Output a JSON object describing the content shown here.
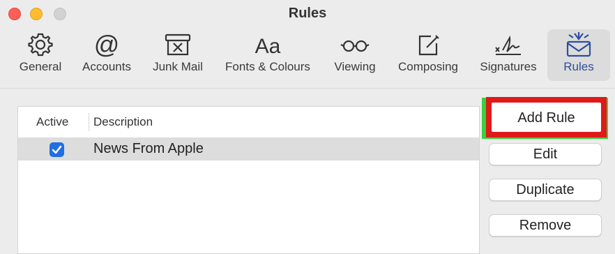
{
  "window": {
    "title": "Rules",
    "traffic_lights": {
      "close": "#fe5f57",
      "minimize": "#febc2e",
      "zoom": "#d2d2d2"
    }
  },
  "toolbar": {
    "items": [
      {
        "label": "General",
        "icon": "gear-icon"
      },
      {
        "label": "Accounts",
        "icon": "at-sign-icon"
      },
      {
        "label": "Junk Mail",
        "icon": "junk-bin-icon"
      },
      {
        "label": "Fonts & Colours",
        "icon": "font-icon"
      },
      {
        "label": "Viewing",
        "icon": "glasses-icon"
      },
      {
        "label": "Composing",
        "icon": "compose-icon"
      },
      {
        "label": "Signatures",
        "icon": "signature-icon"
      },
      {
        "label": "Rules",
        "icon": "rules-envelope-icon",
        "selected": true
      }
    ],
    "selected_color": "#2b4f9e"
  },
  "table": {
    "columns": [
      "Active",
      "Description"
    ],
    "rows": [
      {
        "active": true,
        "description": "News From Apple"
      }
    ]
  },
  "buttons": {
    "add_rule": "Add Rule",
    "edit": "Edit",
    "duplicate": "Duplicate",
    "remove": "Remove"
  },
  "annotation": {
    "outer_color": "#38d13d",
    "inner_color": "#e01919"
  }
}
